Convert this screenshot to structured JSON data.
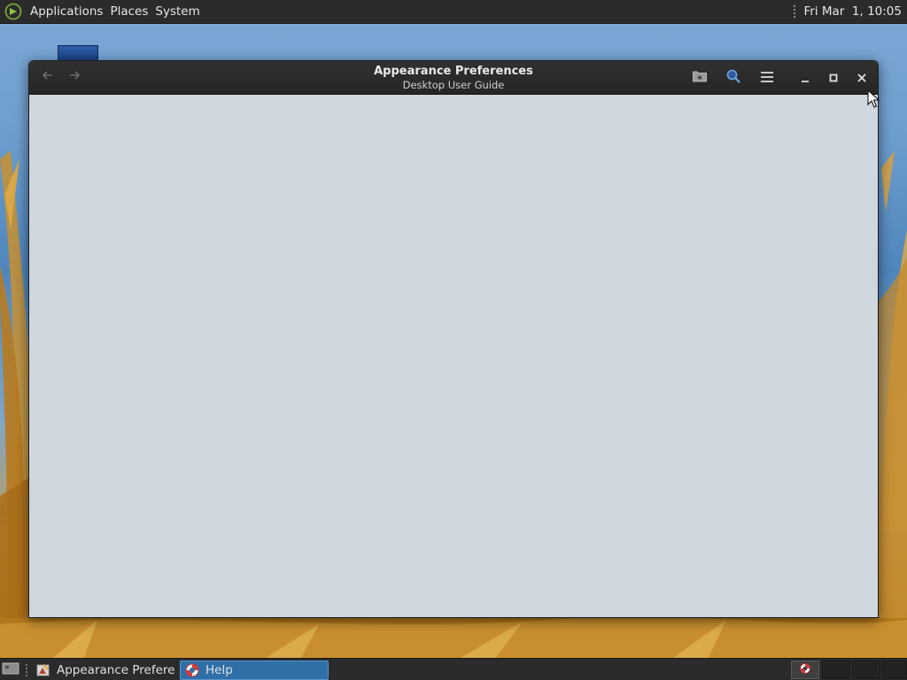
{
  "top_panel": {
    "menus": [
      {
        "label": "Applications"
      },
      {
        "label": "Places"
      },
      {
        "label": "System"
      }
    ],
    "clock": "Fri Mar  1, 10:05"
  },
  "window": {
    "title": "Appearance Preferences",
    "subtitle": "Desktop User Guide",
    "icons": {
      "back": "arrow-left-icon",
      "forward": "arrow-right-icon",
      "bookmarks": "folder-star-icon",
      "search": "search-icon",
      "menu": "hamburger-menu-icon",
      "minimize": "minimize-icon",
      "maximize": "maximize-icon",
      "close": "close-icon"
    }
  },
  "taskbar": {
    "tasks": [
      {
        "label": "Appearance Prefere...",
        "icon": "appearance-preferences-icon",
        "active": false
      },
      {
        "label": "Help",
        "icon": "lifebuoy-icon",
        "active": true
      }
    ],
    "workspaces": 4,
    "active_workspace": 1
  },
  "colors": {
    "panel_bg": "#2b2b2b",
    "headerbar_bg": "#2c2c2c",
    "content_bg": "#d0d6de",
    "active_task": "#2f6fa8"
  }
}
